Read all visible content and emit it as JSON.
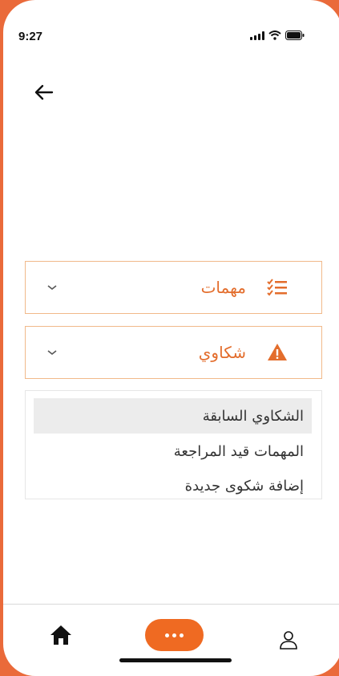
{
  "status_bar": {
    "time": "9:27"
  },
  "accordion": [
    {
      "label": "مهمات",
      "icon": "checklist-icon",
      "expanded": false
    },
    {
      "label": "شكاوي",
      "icon": "warning-icon",
      "expanded": true
    }
  ],
  "complaints_menu": [
    {
      "label": "الشكاوي السابقة",
      "active": true
    },
    {
      "label": "المهمات قيد المراجعة",
      "active": false
    },
    {
      "label": "إضافة شكوى جديدة",
      "active": false
    }
  ],
  "bottom_nav": {
    "items": [
      "home-icon",
      "more-icon",
      "profile-icon"
    ]
  },
  "colors": {
    "accent": "#ef6a22",
    "label": "#e36d2c",
    "border": "#f1b98a",
    "frame": "#ea6a3a"
  }
}
